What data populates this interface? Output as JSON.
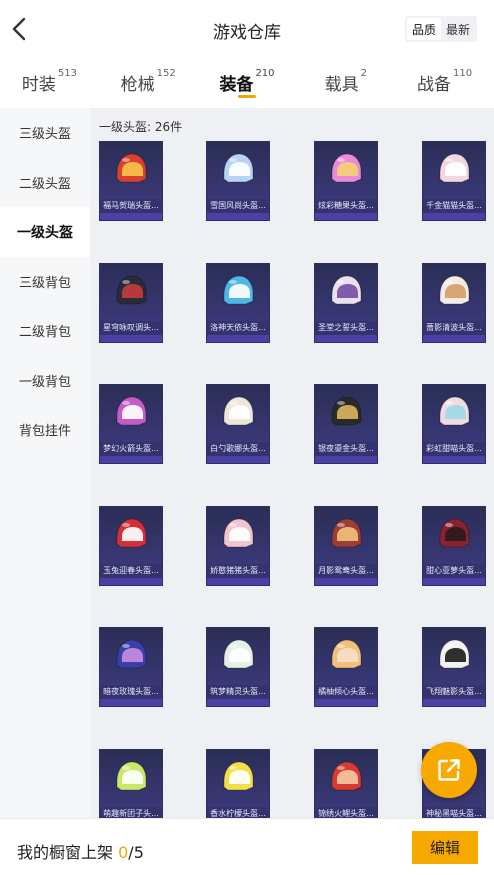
{
  "header": {
    "title": "游戏仓库",
    "sort_quality": "品质",
    "sort_latest": "最新"
  },
  "tabs": [
    {
      "label": "时装",
      "count": "513"
    },
    {
      "label": "枪械",
      "count": "152"
    },
    {
      "label": "装备",
      "count": "210",
      "active": true
    },
    {
      "label": "载具",
      "count": "2"
    },
    {
      "label": "战备",
      "count": "110"
    }
  ],
  "sidebar": [
    {
      "label": "三级头盔"
    },
    {
      "label": "二级头盔"
    },
    {
      "label": "一级头盔",
      "active": true
    },
    {
      "label": "三级背包"
    },
    {
      "label": "二级背包"
    },
    {
      "label": "一级背包"
    },
    {
      "label": "背包挂件"
    }
  ],
  "section": {
    "label": "一级头盔: 26件"
  },
  "items": [
    {
      "name": "福马贺瑞头盔...",
      "shell": "#d9412f",
      "visor": "#f6c34a"
    },
    {
      "name": "雪国风尚头盔...",
      "shell": "#b8d4f2",
      "visor": "#ffffff"
    },
    {
      "name": "炫彩糖果头盔...",
      "shell": "#e98ad6",
      "visor": "#f3d074"
    },
    {
      "name": "千金猫猫头盔...",
      "shell": "#f2d6e2",
      "visor": "#ffffff"
    },
    {
      "name": "星穹咏叹调头...",
      "shell": "#2a2a3a",
      "visor": "#c33b3b"
    },
    {
      "name": "洛神天依头盔...",
      "shell": "#4fb6e6",
      "visor": "#ffffff"
    },
    {
      "name": "圣堂之誓头盔...",
      "shell": "#e8e1ee",
      "visor": "#7b4ea8"
    },
    {
      "name": "蔷影清波头盔...",
      "shell": "#f1ece8",
      "visor": "#d6a06a"
    },
    {
      "name": "梦幻火箭头盔...",
      "shell": "#c45cc8",
      "visor": "#ffffff"
    },
    {
      "name": "白勺歌娜头盔...",
      "shell": "#efe6da",
      "visor": "#ffffff"
    },
    {
      "name": "银夜鎏金头盔...",
      "shell": "#2a2a2a",
      "visor": "#d9b25a"
    },
    {
      "name": "彩虹甜喵头盔...",
      "shell": "#f0dbe4",
      "visor": "#9fd8e8"
    },
    {
      "name": "玉兔迎春头盔...",
      "shell": "#d62f3a",
      "visor": "#ffffff"
    },
    {
      "name": "娇憨猪猪头盔...",
      "shell": "#f2c4cd",
      "visor": "#ffffff"
    },
    {
      "name": "月影鸳鸯头盔...",
      "shell": "#9e3c36",
      "visor": "#f0c07a"
    },
    {
      "name": "甜心亚萝头盔...",
      "shell": "#8a2230",
      "visor": "#2d1a1e"
    },
    {
      "name": "暗夜玫瑰头盔...",
      "shell": "#3b3fa8",
      "visor": "#c88be0"
    },
    {
      "name": "筑梦精灵头盔...",
      "shell": "#e3f0e4",
      "visor": "#ffffff"
    },
    {
      "name": "橘柚倾心头盔...",
      "shell": "#f1c07a",
      "visor": "#f6e0c8"
    },
    {
      "name": "飞翔魅影头盔...",
      "shell": "#f2f2f2",
      "visor": "#1e1e1e"
    },
    {
      "name": "萌趣新团子头...",
      "shell": "#c9e86a",
      "visor": "#ffffff"
    },
    {
      "name": "香水柠檬头盔...",
      "shell": "#f1e04a",
      "visor": "#ffffff"
    },
    {
      "name": "锦绣火鲤头盔...",
      "shell": "#d63c34",
      "visor": "#f5c8a0"
    },
    {
      "name": "神秘黑喵头盔...",
      "shell": "#2a2a34",
      "visor": "#8ad0e8"
    }
  ],
  "bottom": {
    "shelf_label": "我的橱窗上架",
    "shelf_current": "0",
    "shelf_total": "/5",
    "edit_label": "编辑"
  },
  "colors": {
    "accent": "#f7a900",
    "card_bg": "#1f2340",
    "card_label_bg": "#35336e"
  },
  "icons": {
    "back": "chevron-left-icon",
    "share": "share-external-icon"
  }
}
